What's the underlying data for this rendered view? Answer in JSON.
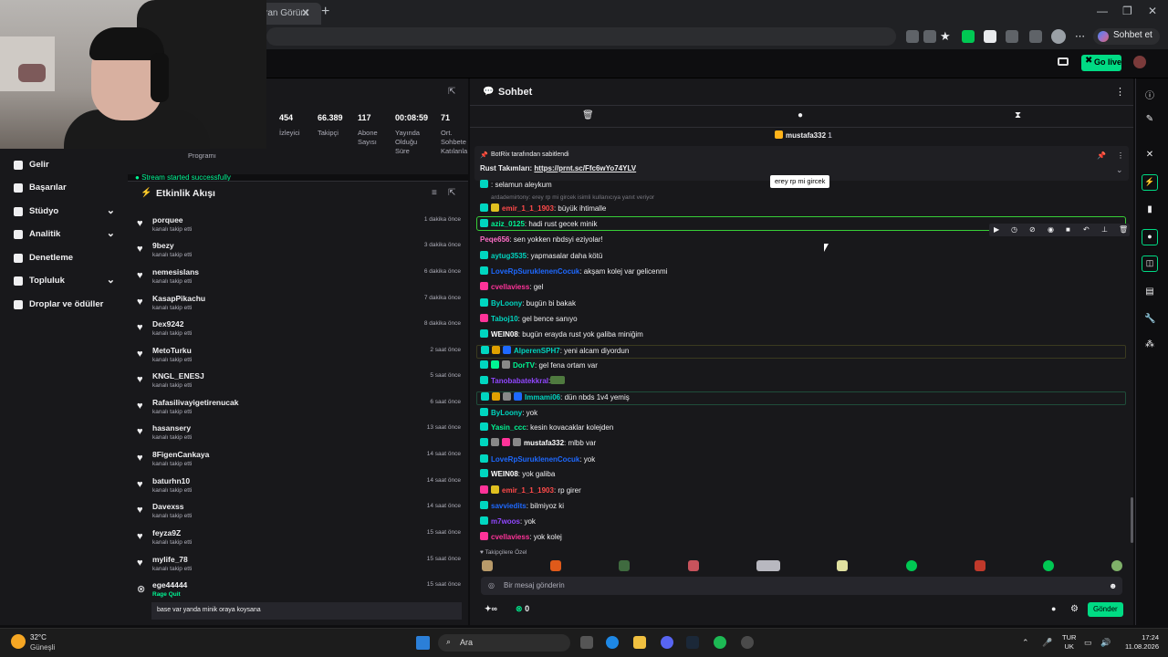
{
  "browser": {
    "tab_label": "ran Görünt",
    "new_tab": "+",
    "gemini_label": "Sohbet et"
  },
  "twitch_top": {
    "golive_label": "Go live"
  },
  "sidebar": {
    "items": [
      {
        "label": "Gelir",
        "chevron": false
      },
      {
        "label": "Başarılar",
        "chevron": false
      },
      {
        "label": "Stüdyo",
        "chevron": true
      },
      {
        "label": "Analitik",
        "chevron": true
      },
      {
        "label": "Denetleme",
        "chevron": false
      },
      {
        "label": "Topluluk",
        "chevron": true
      },
      {
        "label": "Droplar ve ödüller",
        "chevron": false
      }
    ]
  },
  "stats": [
    {
      "value": "454",
      "label": "İzleyici"
    },
    {
      "value": "66.389",
      "label": "Takipçi"
    },
    {
      "value": "117",
      "label": "Abone Sayısı"
    },
    {
      "value": "00:08:59",
      "label": "Yayında Olduğu Süre"
    },
    {
      "value": "71",
      "label": "Ort. Sohbete Katılanla"
    }
  ],
  "stats_extra": {
    "program_label": "Programı",
    "stream_ok": "Stream started successfully"
  },
  "feed": {
    "title": "Etkinlik Akışı",
    "items": [
      {
        "name": "porquee",
        "sub": "kanalı takip etti",
        "time": "1 dakika önce"
      },
      {
        "name": "9bezy",
        "sub": "kanalı takip etti",
        "time": "3 dakika önce"
      },
      {
        "name": "nemesislans",
        "sub": "kanalı takip etti",
        "time": "6 dakika önce"
      },
      {
        "name": "KasapPikachu",
        "sub": "kanalı takip etti",
        "time": "7 dakika önce"
      },
      {
        "name": "Dex9242",
        "sub": "kanalı takip etti",
        "time": "8 dakika önce"
      },
      {
        "name": "MetoTurku",
        "sub": "kanalı takip etti",
        "time": "2 saat önce"
      },
      {
        "name": "KNGL_ENESJ",
        "sub": "kanalı takip etti",
        "time": "5 saat önce"
      },
      {
        "name": "Rafasilivayigetirenucak",
        "sub": "kanalı takip etti",
        "time": "6 saat önce"
      },
      {
        "name": "hasansery",
        "sub": "kanalı takip etti",
        "time": "13 saat önce"
      },
      {
        "name": "8FigenCankaya",
        "sub": "kanalı takip etti",
        "time": "14 saat önce"
      },
      {
        "name": "baturhn10",
        "sub": "kanalı takip etti",
        "time": "14 saat önce"
      },
      {
        "name": "Davexss",
        "sub": "kanalı takip etti",
        "time": "14 saat önce"
      },
      {
        "name": "feyza9Z",
        "sub": "kanalı takip etti",
        "time": "15 saat önce"
      },
      {
        "name": "mylife_78",
        "sub": "kanalı takip etti",
        "time": "15 saat önce"
      },
      {
        "name": "ege44444",
        "sub": "Rage Quit",
        "time": "15 saat önce"
      }
    ],
    "last_note": "base var yanda minik oraya koysana"
  },
  "chat": {
    "title": "Sohbet",
    "hype_user": "mustafa332",
    "hype_count": "1",
    "pinned_by": "BotRix tarafından sabitlendi",
    "pinned_prefix": "Rust Takımları: ",
    "pinned_link": "https://prnt.sc/Ffc6wYo74YLV",
    "tooltip": "erey rp mi gircek",
    "reply_note": "ardademirtony: erey rp mi gircek isimli kullanıcıya yanıt veriyor",
    "partial_top": {
      "user": "",
      "text": ": selamun aleykum",
      "color": "#1e69ff"
    },
    "messages": [
      {
        "user": "emir_1_1_1903",
        "text": ": büyük ihtimalle",
        "color": "#ff4a4a",
        "badges": [
          "#00d6c0",
          "#e0c020"
        ]
      },
      {
        "user": "aziz_0125",
        "text": ": hadi rust gecek minik",
        "color": "#00f593",
        "badges": [
          "#00d6c0"
        ]
      },
      {
        "user": "Peqe656",
        "text": ": sen yokken nbdsyi eziyolar!",
        "color": "#ff6ec7",
        "badges": []
      },
      {
        "user": "aytug3535",
        "text": ": yapmasalar daha kötü",
        "color": "#00d6c0",
        "badges": [
          "#00d6c0"
        ]
      },
      {
        "user": "LoveRpSuruklenenCocuk",
        "text": ": akşam kolej var gelicenmi",
        "color": "#1e69ff",
        "badges": [
          "#00d6c0"
        ]
      },
      {
        "user": "cvellaviess",
        "text": ": gel",
        "color": "#ff3399",
        "badges": [
          "#ff3399"
        ]
      },
      {
        "user": "ByLoony",
        "text": ": bugün bi bakak",
        "color": "#00d6c0",
        "badges": [
          "#00d6c0"
        ]
      },
      {
        "user": "Taboj10",
        "text": ": gel bence sanıyo",
        "color": "#00d6c0",
        "badges": [
          "#ff3399"
        ]
      },
      {
        "user": "WEIN08",
        "text": ": bugün erayda rust yok galiba miniğim",
        "color": "#ffffff",
        "badges": [
          "#00d6c0"
        ]
      },
      {
        "user": "AlperenSPH7",
        "text": ": yeni alcam diyordun",
        "color": "#00d6c0",
        "badges": [
          "#00d6c0",
          "#e0a000",
          "#1e69ff"
        ]
      },
      {
        "user": "DorTV",
        "text": ": gel fena ortam var",
        "color": "#00f593",
        "badges": [
          "#00d6c0",
          "#00f593",
          "#888888"
        ]
      },
      {
        "user": "Tanobabatekkral",
        "text": ":",
        "color": "#9147ff",
        "badges": [
          "#00d6c0"
        ]
      },
      {
        "user": "Immami06",
        "text": ": dün nbds 1v4 yemiş",
        "color": "#00d6c0",
        "badges": [
          "#00d6c0",
          "#e0a000",
          "#888888",
          "#1e69ff"
        ]
      },
      {
        "user": "ByLoony",
        "text": ": yok",
        "color": "#00d6c0",
        "badges": [
          "#00d6c0"
        ]
      },
      {
        "user": "Yasin_ccc",
        "text": ": kesin kovacaklar kolejden",
        "color": "#00f593",
        "badges": [
          "#00d6c0"
        ]
      },
      {
        "user": "mustafa332",
        "text": ": mlbb var",
        "color": "#ffffff",
        "badges": [
          "#00d6c0",
          "#888888",
          "#ff3399",
          "#888888"
        ]
      },
      {
        "user": "LoveRpSuruklenenCocuk",
        "text": ": yok",
        "color": "#1e69ff",
        "badges": [
          "#00d6c0"
        ]
      },
      {
        "user": "WEIN08",
        "text": ": yok galiba",
        "color": "#ffffff",
        "badges": [
          "#00d6c0"
        ]
      },
      {
        "user": "emir_1_1_1903",
        "text": ": rp girer",
        "color": "#ff4a4a",
        "badges": [
          "#ff3399",
          "#e0c020"
        ]
      },
      {
        "user": "savviedits",
        "text": ": bilmiyoz ki",
        "color": "#1e69ff",
        "badges": [
          "#00d6c0"
        ]
      },
      {
        "user": "m7woos",
        "text": ": yok",
        "color": "#9147ff",
        "badges": [
          "#00d6c0"
        ]
      },
      {
        "user": "cvellaviess",
        "text": ": yok kolej",
        "color": "#ff3399",
        "badges": [
          "#ff3399"
        ]
      }
    ],
    "emote_label": "Takipçilere Özel",
    "input_placeholder": "Bir mesaj gönderin",
    "points": "∞",
    "points2": "0",
    "send_label": "Gönder"
  },
  "taskbar": {
    "temp": "32°C",
    "condition": "Güneşli",
    "search": "Ara",
    "lang_top": "TUR",
    "lang_bottom": "UK",
    "time": "17:24",
    "date": "11.08.2026"
  },
  "colors": {
    "accent": "#00db84",
    "bg": "#18181b",
    "dark": "#0e0e10"
  }
}
